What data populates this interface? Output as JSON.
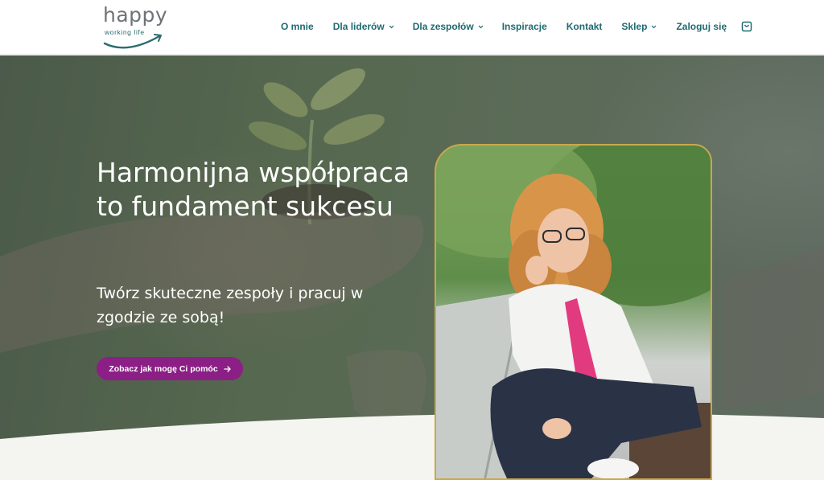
{
  "header": {
    "logo_word": "happy",
    "logo_sub": "working life",
    "nav": [
      {
        "label": "O mnie",
        "dropdown": false
      },
      {
        "label": "Dla liderów",
        "dropdown": true
      },
      {
        "label": "Dla zespołów",
        "dropdown": true
      },
      {
        "label": "Inspiracje",
        "dropdown": false
      },
      {
        "label": "Kontakt",
        "dropdown": false
      },
      {
        "label": "Sklep",
        "dropdown": true
      },
      {
        "label": "Zaloguj się",
        "dropdown": false
      }
    ],
    "cart_icon": "shopping-bag-icon"
  },
  "hero": {
    "title": "Harmonijna współpraca to fundament sukcesu",
    "subtitle": "Twórz skuteczne zespoły i pracuj w zgodzie ze sobą!",
    "cta_label": "Zobacz jak mogę Ci pomóc",
    "cta_icon": "arrow-right-icon"
  },
  "colors": {
    "nav_text": "#1f6a70",
    "cta_bg": "#8c1f86",
    "photo_border": "#c9a84a",
    "logo_gray": "#6f7276",
    "logo_teal": "#2b6b6f"
  }
}
